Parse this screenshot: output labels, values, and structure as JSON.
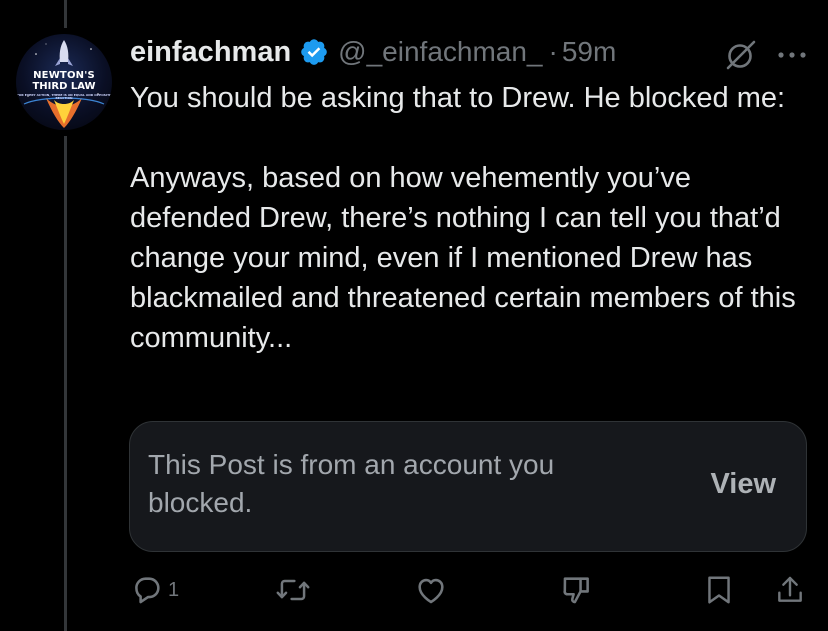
{
  "post": {
    "display_name": "einfachman",
    "handle": "@_einfachman_",
    "separator": "·",
    "timestamp": "59m",
    "body": "You should be asking that to Drew. He blocked me:\n\nAnyways, based on how vehemently you’ve defended Drew, there’s nothing I can tell you that’d change your mind, even if I mentioned Drew has blackmailed and threatened certain members of this community...",
    "avatar": {
      "line1": "NEWTON'S",
      "line2": "THIRD LAW",
      "line3": "FOR EVERY ACTION, THERE IS AN EQUAL AND OPPOSITE REACTION"
    }
  },
  "quote": {
    "message": "This Post is from an account you blocked.",
    "view_label": "View"
  },
  "actions": {
    "reply_count": "1"
  },
  "icons": {
    "verified": "verified-badge-icon",
    "grok": "grok-icon",
    "more": "more-icon",
    "reply": "reply-icon",
    "repost": "repost-icon",
    "like": "like-icon",
    "dislike": "dislike-icon",
    "bookmark": "bookmark-icon",
    "share": "share-icon"
  },
  "colors": {
    "background": "#000000",
    "text": "#e7e9ea",
    "muted": "#71767b",
    "verified": "#1d9bf0",
    "card_bg": "#16181c",
    "card_border": "#2f3336"
  }
}
